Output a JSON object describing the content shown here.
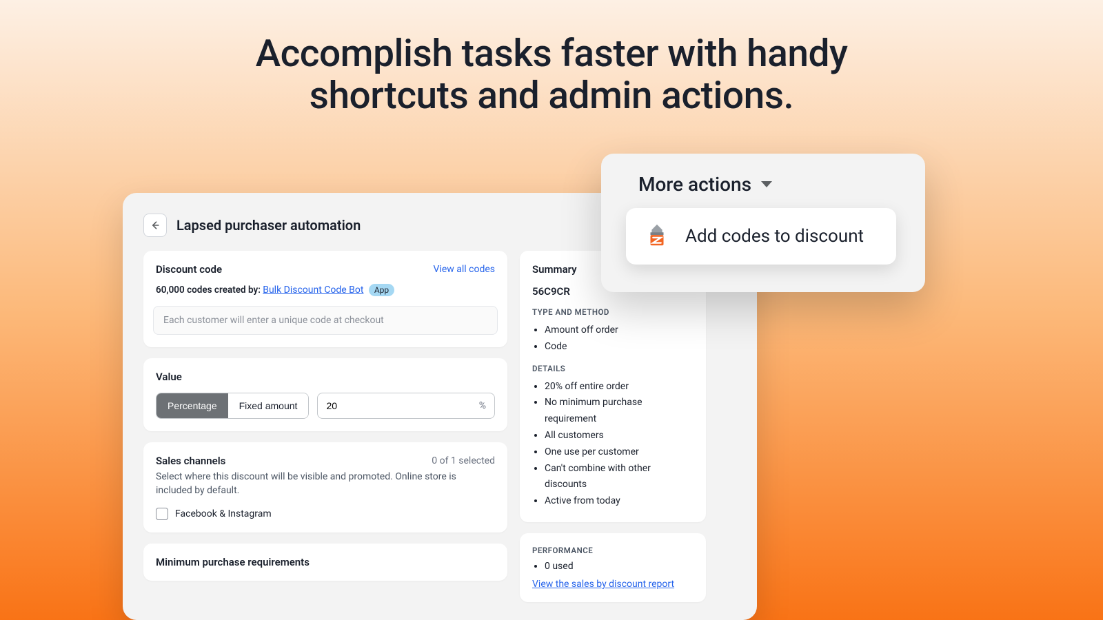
{
  "hero": {
    "line1": "Accomplish tasks faster with handy",
    "line2": "shortcuts and admin actions."
  },
  "page": {
    "title": "Lapsed purchaser automation"
  },
  "discount_code": {
    "title": "Discount code",
    "view_all": "View all codes",
    "count_text": "60,000 codes created by:",
    "creator_link": "Bulk Discount Code Bot",
    "app_badge": "App",
    "field_text": "Each customer will enter a unique code at checkout"
  },
  "value": {
    "title": "Value",
    "seg_percentage": "Percentage",
    "seg_fixed": "Fixed amount",
    "input_value": "20",
    "suffix": "%"
  },
  "sales_channels": {
    "title": "Sales channels",
    "selected": "0 of 1 selected",
    "desc": "Select where this discount will be visible and promoted. Online store is included by default.",
    "channel1": "Facebook & Instagram"
  },
  "min_purchase": {
    "title": "Minimum purchase requirements"
  },
  "summary": {
    "title": "Summary",
    "code": "56C9CR",
    "type_method_label": "TYPE AND METHOD",
    "type_method": [
      "Amount off order",
      "Code"
    ],
    "details_label": "DETAILS",
    "details": [
      "20% off entire order",
      "No minimum purchase requirement",
      "All customers",
      "One use per customer",
      "Can't combine with other discounts",
      "Active from today"
    ],
    "performance_label": "PERFORMANCE",
    "performance": [
      "0 used"
    ],
    "report_link": "View the sales by discount report"
  },
  "popover": {
    "more_actions": "More actions",
    "item1": "Add codes to discount"
  }
}
